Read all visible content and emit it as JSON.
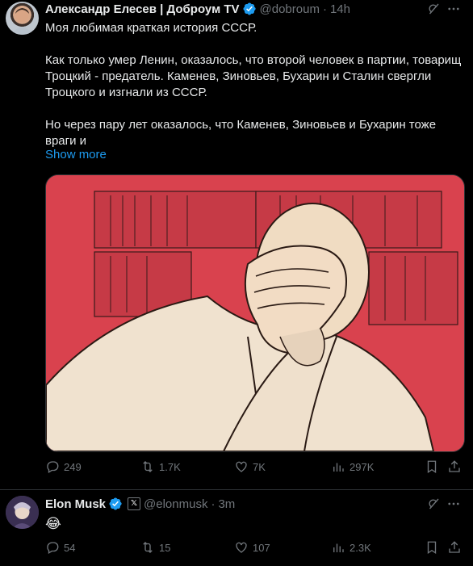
{
  "tweet1": {
    "author_name": "Александр Елесев | Доброум TV",
    "handle": "@dobroum",
    "separator": "·",
    "time": "14h",
    "text": "Моя любимая краткая история СССР.\n\nКак только умер Ленин, оказалось, что второй человек в партии, товарищ Троцкий - предатель. Каменев, Зиновьев, Бухарин и Сталин свергли Троцкого и изгнали из СССР.\n\nНо через пару лет оказалось, что Каменев, Зиновьев и Бухарин тоже враги и",
    "show_more": "Show more",
    "media_description_icon": "facepalm-illustration",
    "stats": {
      "replies": "249",
      "reposts": "1.7K",
      "likes": "7K",
      "views": "297K"
    }
  },
  "tweet2": {
    "author_name": "Elon Musk",
    "handle": "@elonmusk",
    "separator": "·",
    "time": "3m",
    "text": "😂",
    "stats": {
      "replies": "54",
      "reposts": "15",
      "likes": "107",
      "views": "2.3K"
    }
  },
  "colors": {
    "accent": "#1d9bf0",
    "muted": "#71767b",
    "background": "#000000",
    "media_bg": "#d9424e"
  }
}
